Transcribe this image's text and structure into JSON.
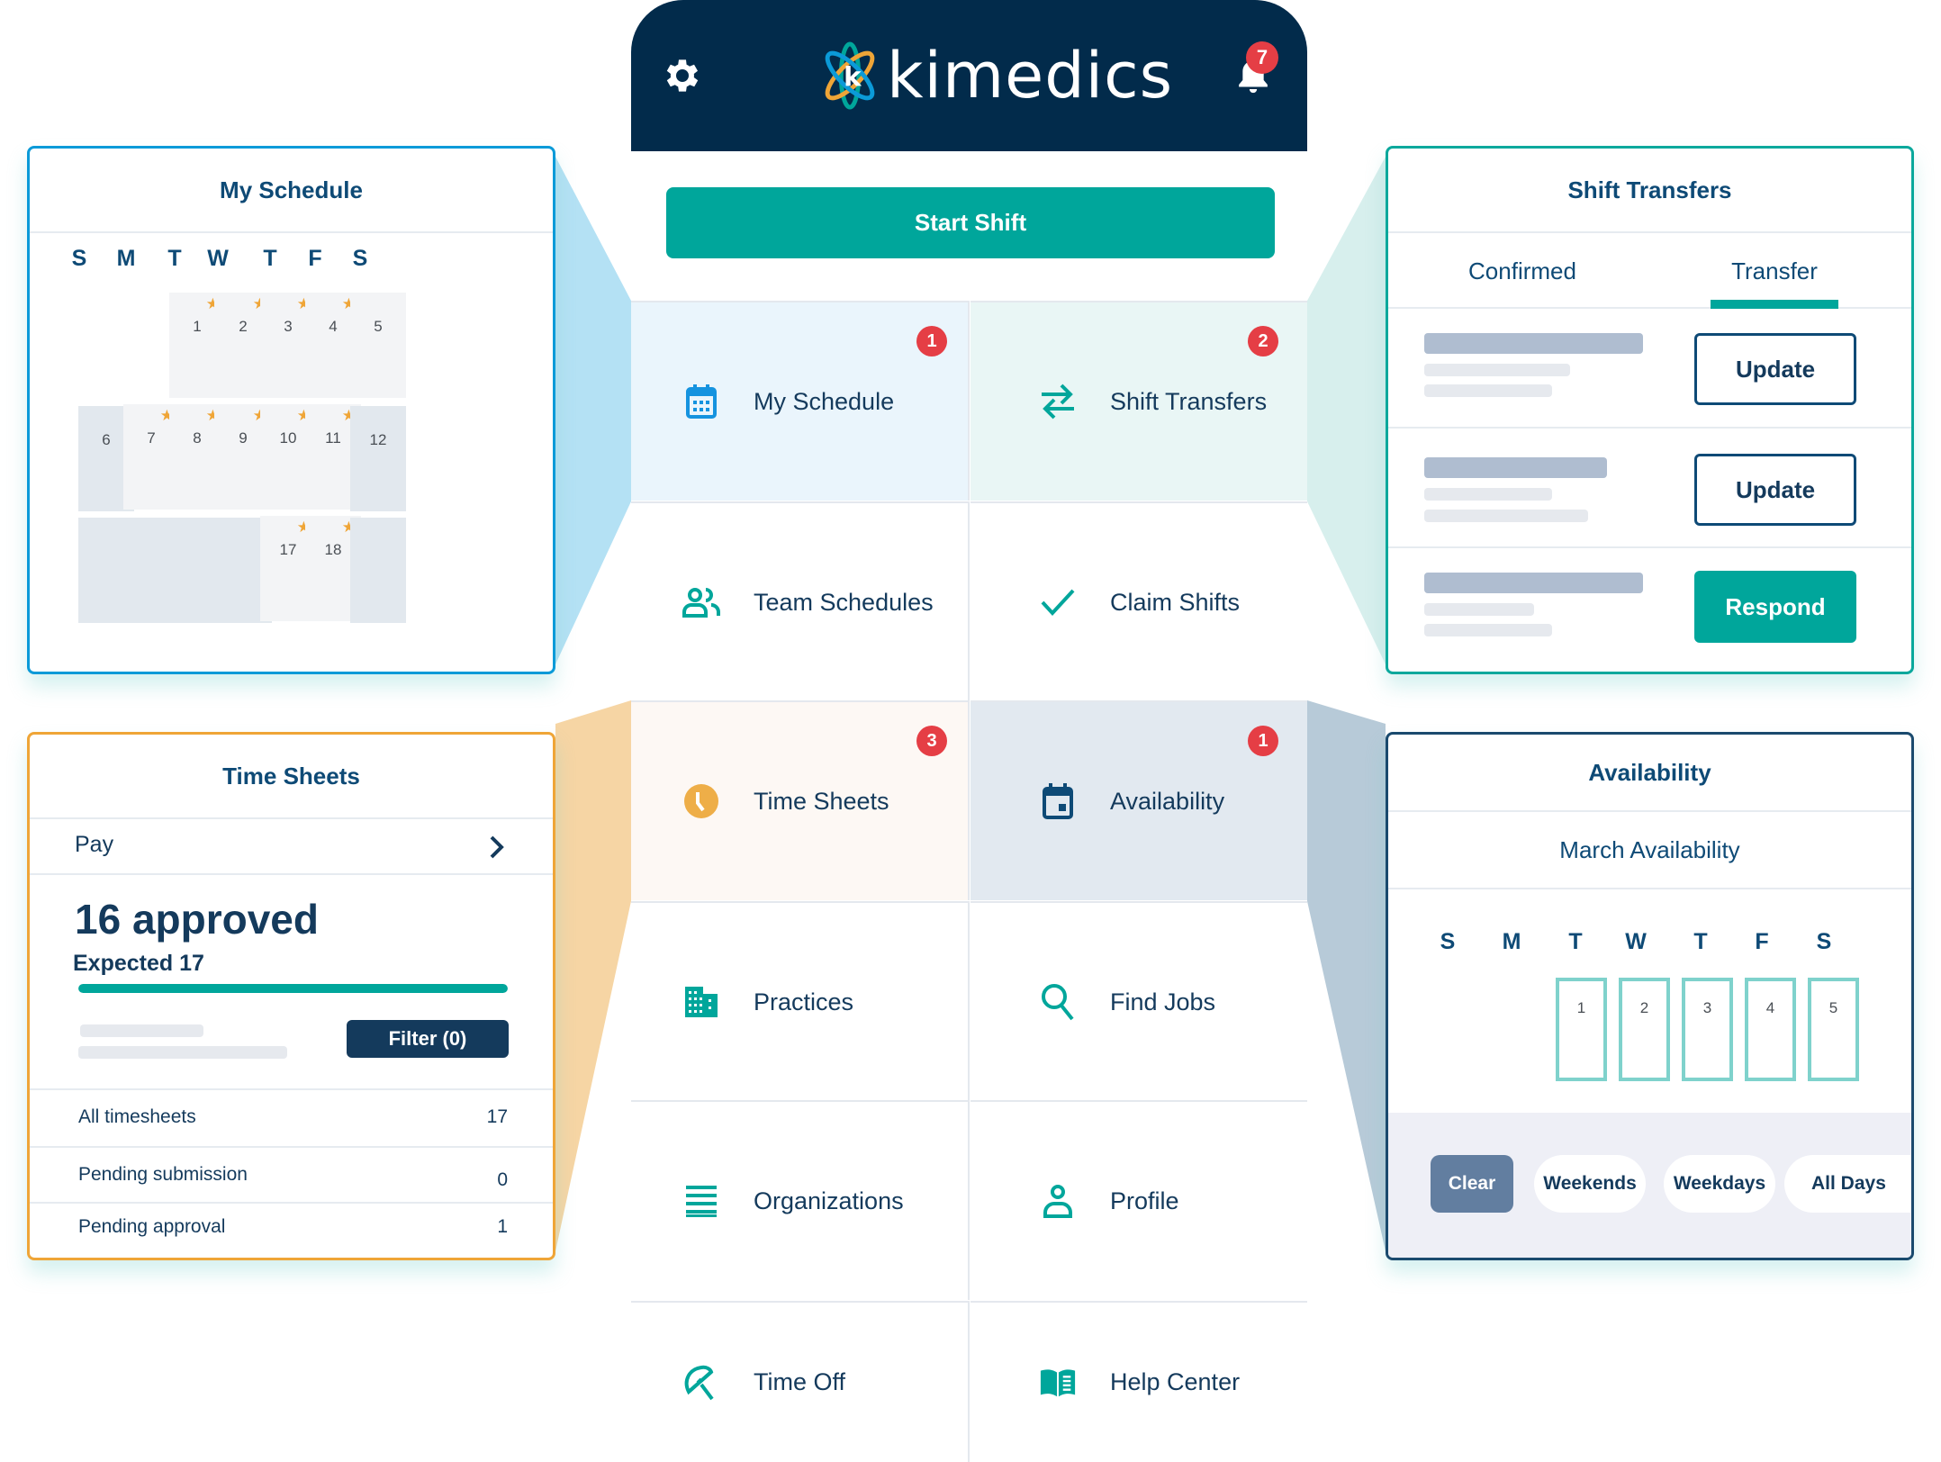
{
  "app": {
    "brand": "kimedics",
    "notifications_count": "7",
    "icons": {
      "settings": "gear-icon",
      "notifications": "bell-icon",
      "logo": "kimedics-atom-logo"
    }
  },
  "colors": {
    "header_bg": "#022b4b",
    "accent_teal": "#00a69b",
    "badge_red": "#e53e45",
    "text_navy": "#143a5c",
    "star_orange": "#efa537",
    "schedule_border": "#0b9ad8",
    "transfers_border": "#0aa89c",
    "timesheets_border": "#efa537",
    "availability_border": "#1a4a6e"
  },
  "start_shift": {
    "label": "Start Shift"
  },
  "menu": [
    {
      "label": "My Schedule",
      "icon": "calendar-icon",
      "badge": "1"
    },
    {
      "label": "Shift Transfers",
      "icon": "swap-arrows-icon",
      "badge": "2"
    },
    {
      "label": "Team Schedules",
      "icon": "team-icon",
      "badge": null
    },
    {
      "label": "Claim Shifts",
      "icon": "checkmark-icon",
      "badge": null
    },
    {
      "label": "Time Sheets",
      "icon": "clock-icon",
      "badge": "3"
    },
    {
      "label": "Availability",
      "icon": "calendar-day-icon",
      "badge": "1"
    },
    {
      "label": "Practices",
      "icon": "building-icon",
      "badge": null
    },
    {
      "label": "Find Jobs",
      "icon": "search-icon",
      "badge": null
    },
    {
      "label": "Organizations",
      "icon": "list-icon",
      "badge": null
    },
    {
      "label": "Profile",
      "icon": "person-icon",
      "badge": null
    },
    {
      "label": "Time Off",
      "icon": "umbrella-icon",
      "badge": null
    },
    {
      "label": "Help Center",
      "icon": "book-icon",
      "badge": null
    }
  ],
  "my_schedule": {
    "title": "My Schedule",
    "weekdays": [
      "S",
      "M",
      "T",
      "W",
      "T",
      "F",
      "S"
    ],
    "weeks": [
      [
        null,
        null,
        {
          "day": "1",
          "starred": true
        },
        {
          "day": "2",
          "starred": true
        },
        {
          "day": "3",
          "starred": true
        },
        {
          "day": "4",
          "starred": true
        },
        {
          "day": "5",
          "starred": false
        }
      ],
      [
        {
          "day": "6",
          "starred": false,
          "dim": true
        },
        {
          "day": "7",
          "starred": true
        },
        {
          "day": "8",
          "starred": true
        },
        {
          "day": "9",
          "starred": true
        },
        {
          "day": "10",
          "starred": true
        },
        {
          "day": "11",
          "starred": true
        },
        {
          "day": "12",
          "starred": false,
          "dim": true
        }
      ],
      [
        {
          "day": "",
          "dim": true
        },
        {
          "day": "",
          "dim": true
        },
        {
          "day": "",
          "dim": true
        },
        {
          "day": "",
          "dim": true
        },
        {
          "day": "17",
          "starred": true
        },
        {
          "day": "18",
          "starred": true
        },
        {
          "day": "",
          "dim": true
        }
      ]
    ]
  },
  "shift_transfers": {
    "title": "Shift Transfers",
    "tabs": [
      {
        "label": "Confirmed",
        "active": false
      },
      {
        "label": "Transfer",
        "active": true
      }
    ],
    "rows": [
      {
        "action": "Update",
        "style": "outline"
      },
      {
        "action": "Update",
        "style": "outline"
      },
      {
        "action": "Respond",
        "style": "filled"
      }
    ]
  },
  "time_sheets": {
    "title": "Time Sheets",
    "pay_label": "Pay",
    "approved_text": "16 approved",
    "expected_text": "Expected 17",
    "approved": 16,
    "expected": 17,
    "progress_fraction": 1.0,
    "filter_label": "Filter (0)",
    "summary": [
      {
        "label": "All timesheets",
        "count": "17"
      },
      {
        "label": "Pending submission",
        "count": "0"
      },
      {
        "label": "Pending approval",
        "count": "1"
      }
    ]
  },
  "availability": {
    "title": "Availability",
    "subtitle": "March Availability",
    "weekdays": [
      "S",
      "M",
      "T",
      "W",
      "T",
      "F",
      "S"
    ],
    "days": [
      "1",
      "2",
      "3",
      "4",
      "5"
    ],
    "quick_select": [
      "Clear",
      "Weekends",
      "Weekdays",
      "All Days"
    ]
  }
}
